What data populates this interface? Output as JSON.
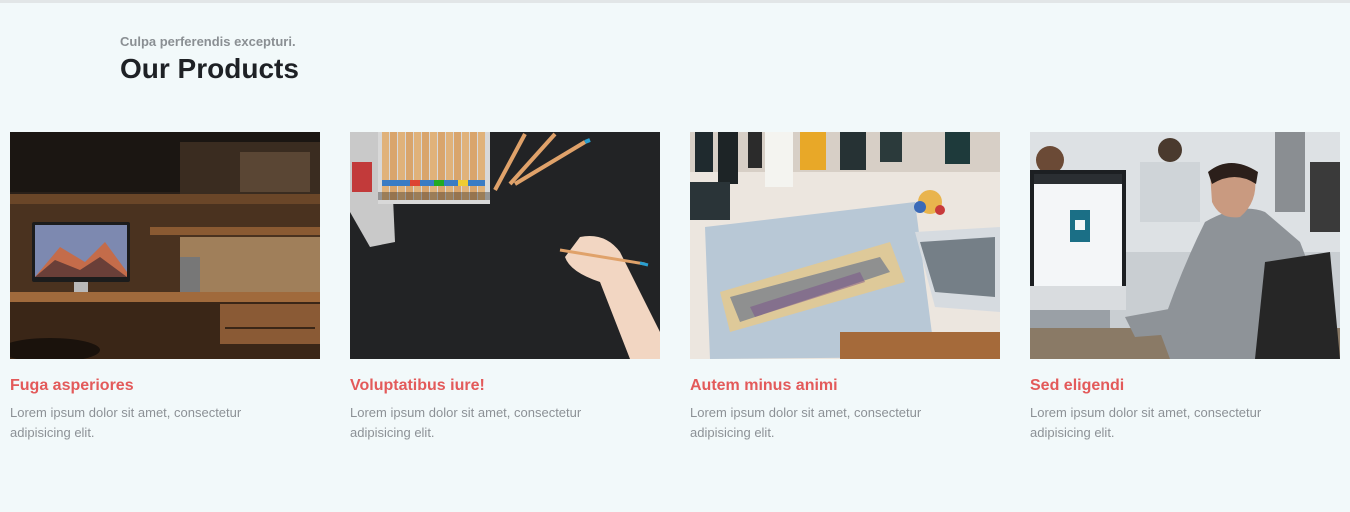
{
  "section": {
    "subtitle": "Culpa perferendis excepturi.",
    "title": "Our Products"
  },
  "products": [
    {
      "title": "Fuga asperiores",
      "description": "Lorem ipsum dolor sit amet, consectetur adipisicing elit."
    },
    {
      "title": "Voluptatibus iure!",
      "description": "Lorem ipsum dolor sit amet, consectetur adipisicing elit."
    },
    {
      "title": "Autem minus animi",
      "description": "Lorem ipsum dolor sit amet, consectetur adipisicing elit."
    },
    {
      "title": "Sed eligendi",
      "description": "Lorem ipsum dolor sit amet, consectetur adipisicing elit."
    }
  ],
  "colors": {
    "background": "#f2f9fa",
    "accent": "#e35a5a",
    "heading": "#1e2125",
    "muted": "#8c9196"
  }
}
